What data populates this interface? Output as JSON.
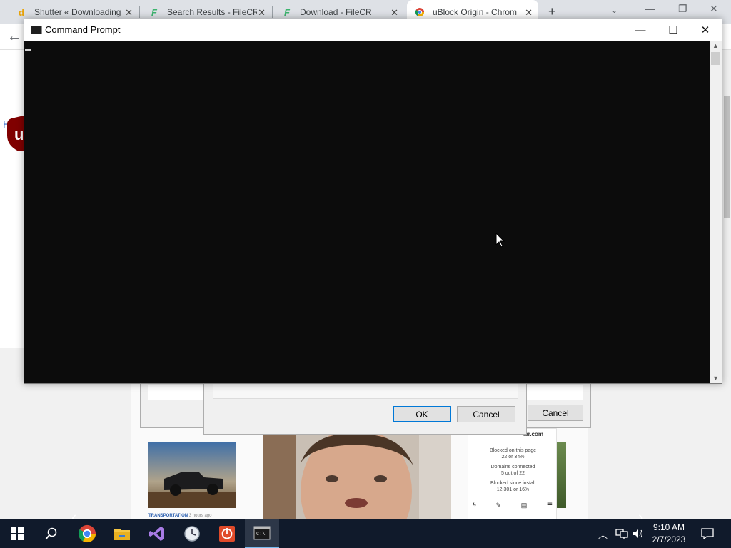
{
  "browser": {
    "tabs": [
      {
        "title": "Shutter « Downloading",
        "favicon": "d"
      },
      {
        "title": "Search Results - FileCR",
        "favicon": "F"
      },
      {
        "title": "Download - FileCR",
        "favicon": "F"
      },
      {
        "title": "uBlock Origin - Chrom",
        "favicon": "chrome-web-store-icon"
      }
    ],
    "new_tab": "+",
    "page": {
      "breadcrumb": "Hom",
      "logo_letter": "u",
      "dialog_back": {
        "cancel_label": "Cancel"
      },
      "dialog_front": {
        "ok_label": "OK",
        "cancel_label": "Cancel"
      },
      "thumbnail_caption": "TRANSPORTATION",
      "thumbnail_time": "3 hours ago",
      "ublock_panel": {
        "site": "ler.com",
        "blocked_page_label": "Blocked on this page",
        "blocked_page_value": "22 or 34%",
        "domains_label": "Domains connected",
        "domains_value": "5 out of 22",
        "blocked_install_label": "Blocked since install",
        "blocked_install_value": "12,301 or 16%"
      }
    }
  },
  "cmd": {
    "title": "Command Prompt",
    "minimize": "—",
    "maximize": "☐",
    "close": "✕"
  },
  "taskbar": {
    "apps": [
      "start",
      "search",
      "chrome",
      "file-explorer",
      "visual-studio",
      "clock-app",
      "power-app",
      "command-prompt"
    ],
    "time": "9:10 AM",
    "date": "2/7/2023"
  },
  "colors": {
    "console_bg": "#0c0c0c",
    "taskbar_bg": "#101a2b",
    "dialog_accent": "#0078d7"
  }
}
